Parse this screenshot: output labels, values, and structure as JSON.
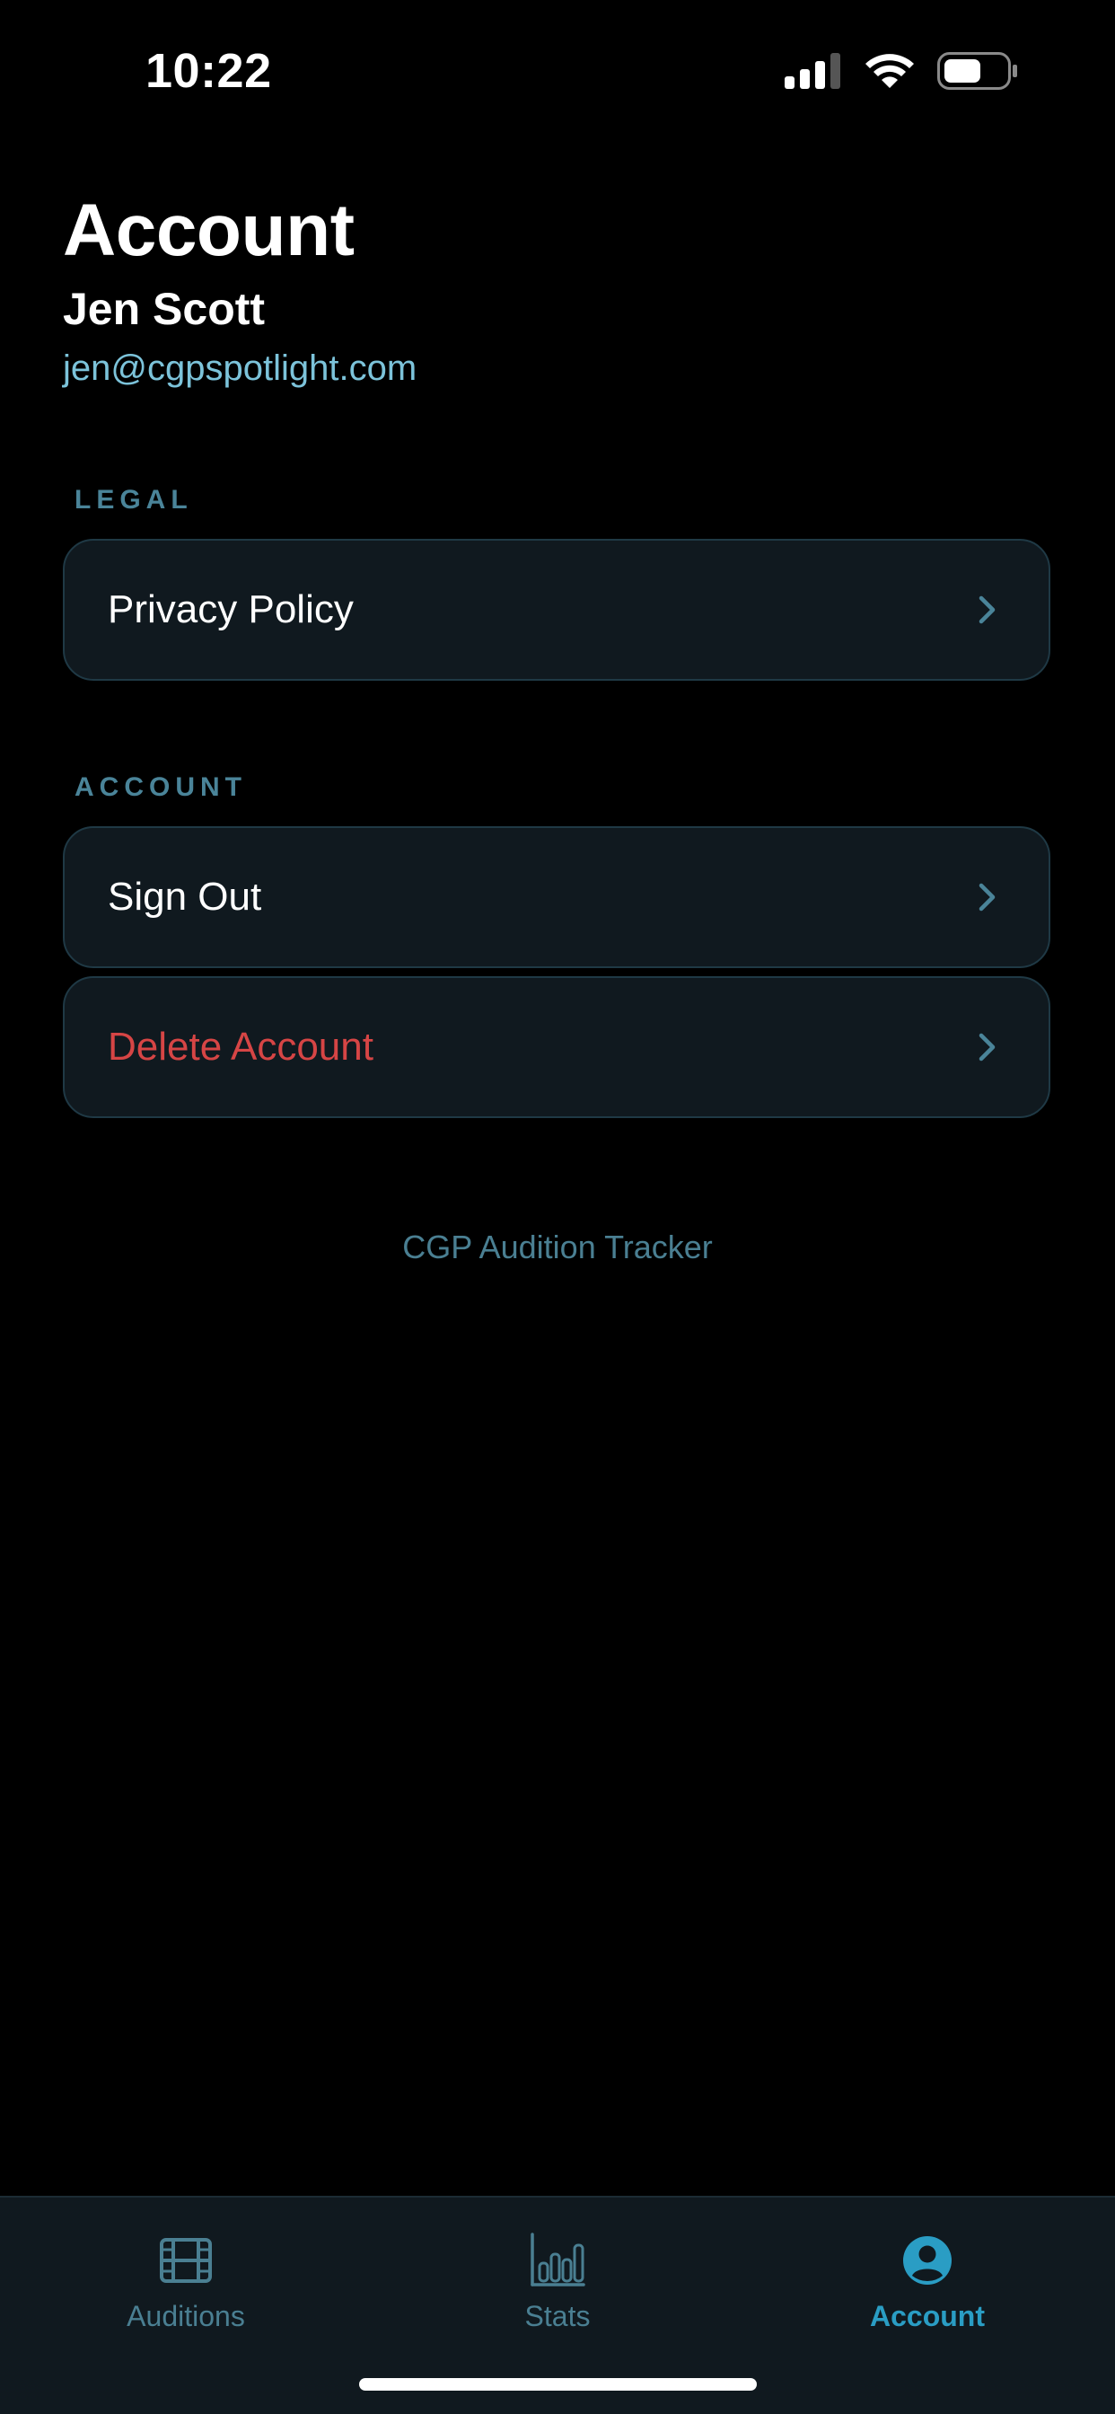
{
  "status_bar": {
    "time": "10:22",
    "icons": [
      "cellular-signal-icon",
      "wifi-icon",
      "battery-icon"
    ]
  },
  "header": {
    "title": "Account",
    "user_name": "Jen Scott",
    "user_email": "jen@cgpspotlight.com"
  },
  "sections": {
    "legal": {
      "label": "LEGAL",
      "items": [
        {
          "label": "Privacy Policy",
          "icon": "chevron-right-icon"
        }
      ]
    },
    "account": {
      "label": "ACCOUNT",
      "items": [
        {
          "label": "Sign Out",
          "icon": "chevron-right-icon"
        },
        {
          "label": "Delete Account",
          "icon": "chevron-right-icon",
          "destructive": true
        }
      ]
    }
  },
  "footer": {
    "app_name": "CGP Audition Tracker"
  },
  "tab_bar": {
    "tabs": [
      {
        "label": "Auditions",
        "icon": "film-icon",
        "active": false
      },
      {
        "label": "Stats",
        "icon": "bar-chart-icon",
        "active": false
      },
      {
        "label": "Account",
        "icon": "person-circle-icon",
        "active": true
      }
    ]
  },
  "colors": {
    "background": "#000000",
    "card_background": "#10191f",
    "card_border": "#1f3945",
    "accent": "#2a9dc4",
    "email": "#7cc3da",
    "section_label": "#4a8499",
    "muted": "#4a7f92",
    "destructive": "#d64545",
    "text": "#ffffff"
  }
}
